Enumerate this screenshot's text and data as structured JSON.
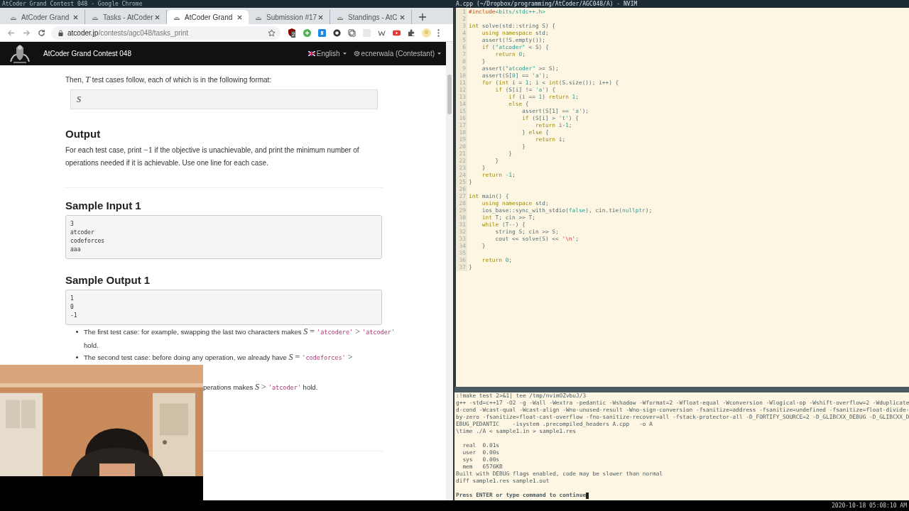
{
  "screen_title": "AtCoder Grand Contest 048 - Google Chrome",
  "browser": {
    "tabs": [
      {
        "title": "AtCoder Grand",
        "selected": false
      },
      {
        "title": "Tasks - AtCoder",
        "selected": false
      },
      {
        "title": "AtCoder Grand",
        "selected": true
      },
      {
        "title": "Submission #17",
        "selected": false
      },
      {
        "title": "Standings - AtC",
        "selected": false
      }
    ],
    "address": {
      "domain": "atcoder.jp",
      "path": "/contests/agc048/tasks_print"
    },
    "extension_badge": "2",
    "site_nav": {
      "title": "AtCoder Grand Contest 048",
      "language": "English",
      "user": "ecnerwala (Contestant)"
    },
    "content": [
      {
        "kind": "para",
        "segments": [
          {
            "kind": "t",
            "text": "Then, "
          },
          {
            "kind": "m",
            "text": "T"
          },
          {
            "kind": "t",
            "text": " test cases follow, each of which is in the following format:"
          }
        ]
      },
      {
        "kind": "formatbox",
        "text": "S"
      },
      {
        "kind": "heading",
        "text": "Output"
      },
      {
        "kind": "para",
        "segments": [
          {
            "kind": "t",
            "text": "For each test case, print "
          },
          {
            "kind": "n",
            "text": "−1"
          },
          {
            "kind": "t",
            "text": " if the objective is unachievable, and print the minimum number of operations needed if it is achievable. Use one line for each case."
          }
        ]
      },
      {
        "kind": "rule"
      },
      {
        "kind": "heading",
        "text": "Sample Input 1"
      },
      {
        "kind": "pre",
        "lines": [
          "3",
          "atcoder",
          "codeforces",
          "aaa"
        ]
      },
      {
        "kind": "heading",
        "text": "Sample Output 1"
      },
      {
        "kind": "pre",
        "lines": [
          "1",
          "0",
          "-1"
        ]
      },
      {
        "kind": "bullets",
        "items": [
          [
            {
              "kind": "t",
              "text": "The first test case: for example, swapping the last two characters makes "
            },
            {
              "kind": "m",
              "text": "S"
            },
            {
              "kind": "n",
              "text": " = "
            },
            {
              "kind": "c",
              "text": "'atcodere'"
            },
            {
              "kind": "n",
              "text": " > "
            },
            {
              "kind": "c",
              "text": "'atcoder'"
            },
            {
              "kind": "t",
              "text": " hold."
            }
          ],
          [
            {
              "kind": "t",
              "text": "The second test case: before doing any operation, we already have "
            },
            {
              "kind": "m",
              "text": "S"
            },
            {
              "kind": "n",
              "text": " = "
            },
            {
              "kind": "c",
              "text": "'codeforces'"
            },
            {
              "kind": "n",
              "text": " >"
            }
          ]
        ]
      },
      {
        "kind": "fragment",
        "segments": [
          {
            "kind": "t",
            "text": "perations makes "
          },
          {
            "kind": "m",
            "text": "S"
          },
          {
            "kind": "n",
            "text": " > "
          },
          {
            "kind": "c",
            "text": "'atcoder'"
          },
          {
            "kind": "t",
            "text": " hold."
          }
        ]
      },
      {
        "kind": "rule"
      }
    ]
  },
  "editor": {
    "title": "A.cpp (~/Dropbox/programming/AtCoder/AGC048/A) - NVIM",
    "lines": [
      {
        "number": "1",
        "code": [
          {
            "text": "#include",
            "kind": "pre"
          },
          {
            "text": "<bits/stdc++.h>",
            "kind": "str"
          }
        ]
      },
      {
        "number": "2"
      },
      {
        "number": "3",
        "code": [
          {
            "text": "int",
            "kind": "kw"
          },
          {
            "text": " solve(std::string S) {",
            "kind": "plain"
          }
        ]
      },
      {
        "number": "4",
        "code": [
          {
            "text": "    using namespace",
            "kind": "kw"
          },
          {
            "text": " std;",
            "kind": "plain"
          }
        ]
      },
      {
        "number": "5",
        "code": [
          {
            "text": "    assert(!S.empty());",
            "kind": "plain"
          }
        ]
      },
      {
        "number": "6",
        "code": [
          {
            "text": "    if",
            "kind": "kw"
          },
          {
            "text": " (",
            "kind": "plain"
          },
          {
            "text": "\"atcoder\"",
            "kind": "str"
          },
          {
            "text": " < S) {",
            "kind": "plain"
          }
        ]
      },
      {
        "number": "7",
        "code": [
          {
            "text": "        return ",
            "kind": "kw"
          },
          {
            "text": "0",
            "kind": "num"
          },
          {
            "text": ";",
            "kind": "plain"
          }
        ]
      },
      {
        "number": "8",
        "code": [
          {
            "text": "    }",
            "kind": "plain"
          }
        ]
      },
      {
        "number": "9",
        "code": [
          {
            "text": "    assert(",
            "kind": "plain"
          },
          {
            "text": "\"atcoder\"",
            "kind": "str"
          },
          {
            "text": " >= S);",
            "kind": "plain"
          }
        ]
      },
      {
        "number": "10",
        "code": [
          {
            "text": "    assert(S[",
            "kind": "plain"
          },
          {
            "text": "0",
            "kind": "num"
          },
          {
            "text": "] == ",
            "kind": "plain"
          },
          {
            "text": "'a'",
            "kind": "str"
          },
          {
            "text": ");",
            "kind": "plain"
          }
        ]
      },
      {
        "number": "11",
        "code": [
          {
            "text": "    for",
            "kind": "kw"
          },
          {
            "text": " (",
            "kind": "plain"
          },
          {
            "text": "int",
            "kind": "kw"
          },
          {
            "text": " i = ",
            "kind": "plain"
          },
          {
            "text": "1",
            "kind": "num"
          },
          {
            "text": "; i < ",
            "kind": "plain"
          },
          {
            "text": "int",
            "kind": "kw"
          },
          {
            "text": "(S.size()); i++) {",
            "kind": "plain"
          }
        ]
      },
      {
        "number": "12",
        "code": [
          {
            "text": "        if",
            "kind": "kw"
          },
          {
            "text": " (S[i] != ",
            "kind": "plain"
          },
          {
            "text": "'a'",
            "kind": "str"
          },
          {
            "text": ") {",
            "kind": "plain"
          }
        ]
      },
      {
        "number": "13",
        "code": [
          {
            "text": "            if",
            "kind": "kw"
          },
          {
            "text": " (i == ",
            "kind": "plain"
          },
          {
            "text": "1",
            "kind": "num"
          },
          {
            "text": ") ",
            "kind": "plain"
          },
          {
            "text": "return ",
            "kind": "kw"
          },
          {
            "text": "1",
            "kind": "num"
          },
          {
            "text": ";",
            "kind": "plain"
          }
        ]
      },
      {
        "number": "14",
        "code": [
          {
            "text": "            else",
            "kind": "kw"
          },
          {
            "text": " {",
            "kind": "plain"
          }
        ]
      },
      {
        "number": "15",
        "code": [
          {
            "text": "                assert(S[1] == ",
            "kind": "plain"
          },
          {
            "text": "'a'",
            "kind": "str"
          },
          {
            "text": ");",
            "kind": "plain"
          }
        ]
      },
      {
        "number": "16",
        "code": [
          {
            "text": "                if",
            "kind": "kw"
          },
          {
            "text": " (S[i] > ",
            "kind": "plain"
          },
          {
            "text": "'t'",
            "kind": "str"
          },
          {
            "text": ") {",
            "kind": "plain"
          }
        ]
      },
      {
        "number": "17",
        "code": [
          {
            "text": "                    return",
            "kind": "kw"
          },
          {
            "text": " i-",
            "kind": "plain"
          },
          {
            "text": "1",
            "kind": "num"
          },
          {
            "text": ";",
            "kind": "plain"
          }
        ]
      },
      {
        "number": "18",
        "code": [
          {
            "text": "                } ",
            "kind": "plain"
          },
          {
            "text": "else",
            "kind": "kw"
          },
          {
            "text": " {",
            "kind": "plain"
          }
        ]
      },
      {
        "number": "19",
        "code": [
          {
            "text": "                    return",
            "kind": "kw"
          },
          {
            "text": " i;",
            "kind": "plain"
          }
        ]
      },
      {
        "number": "20",
        "code": [
          {
            "text": "                }",
            "kind": "plain"
          }
        ]
      },
      {
        "number": "21",
        "code": [
          {
            "text": "            }",
            "kind": "plain"
          }
        ]
      },
      {
        "number": "22",
        "code": [
          {
            "text": "        }",
            "kind": "plain"
          }
        ]
      },
      {
        "number": "23",
        "code": [
          {
            "text": "    }",
            "kind": "plain"
          }
        ]
      },
      {
        "number": "24",
        "code": [
          {
            "text": "    return ",
            "kind": "kw"
          },
          {
            "text": "-1",
            "kind": "num"
          },
          {
            "text": ";",
            "kind": "plain"
          }
        ]
      },
      {
        "number": "25",
        "code": [
          {
            "text": "}",
            "kind": "plain"
          }
        ]
      },
      {
        "number": "26"
      },
      {
        "number": "27",
        "code": [
          {
            "text": "int",
            "kind": "kw"
          },
          {
            "text": " main() {",
            "kind": "plain"
          }
        ]
      },
      {
        "number": "28",
        "code": [
          {
            "text": "    using namespace",
            "kind": "kw"
          },
          {
            "text": " std;",
            "kind": "plain"
          }
        ]
      },
      {
        "number": "29",
        "code": [
          {
            "text": "    ios_base::sync_with_stdio(",
            "kind": "plain"
          },
          {
            "text": "false",
            "kind": "num"
          },
          {
            "text": "), cin.tie(",
            "kind": "plain"
          },
          {
            "text": "nullptr",
            "kind": "num"
          },
          {
            "text": ");",
            "kind": "plain"
          }
        ]
      },
      {
        "number": "30",
        "code": [
          {
            "text": "    int",
            "kind": "kw"
          },
          {
            "text": " T; cin >> T;",
            "kind": "plain"
          }
        ]
      },
      {
        "number": "31",
        "code": [
          {
            "text": "    while",
            "kind": "kw"
          },
          {
            "text": " (T--) {",
            "kind": "plain"
          }
        ]
      },
      {
        "number": "32",
        "code": [
          {
            "text": "        string S; cin >> S;",
            "kind": "plain"
          }
        ]
      },
      {
        "number": "33",
        "code": [
          {
            "text": "        cout << solve(S) << ",
            "kind": "plain"
          },
          {
            "text": "'\\n'",
            "kind": "esc"
          },
          {
            "text": ";",
            "kind": "plain"
          }
        ]
      },
      {
        "number": "34",
        "code": [
          {
            "text": "    }",
            "kind": "plain"
          }
        ]
      },
      {
        "number": "35"
      },
      {
        "number": "36",
        "code": [
          {
            "text": "    return ",
            "kind": "kw"
          },
          {
            "text": "0",
            "kind": "num"
          },
          {
            "text": ";",
            "kind": "plain"
          }
        ]
      },
      {
        "number": "37",
        "code": [
          {
            "text": "}",
            "kind": "plain"
          }
        ]
      }
    ]
  },
  "terminal": {
    "blocks": [
      [
        ":!make test 2>&1| tee /tmp/nvimOZvbuJ/3",
        "g++ -std=c++17 -O2 -g -Wall -Wextra -pedantic -Wshadow -Wformat=2 -Wfloat-equal -Wconversion -Wlogical-op -Wshift-overflow=2 -Wduplicate",
        "d-cond -Wcast-qual -Wcast-align -Wno-unused-result -Wno-sign-conversion -fsanitize=address -fsanitize=undefined -fsanitize=float-divide-",
        "by-zero -fsanitize=float-cast-overflow -fno-sanitize-recover=all -fstack-protector-all -D_FORTIFY_SOURCE=2 -D_GLIBCXX_DEBUG -D_GLIBCXX_D",
        "EBUG_PEDANTIC    -isystem .precompiled_headers A.cpp   -o A",
        "\\time ./A < sample1.in > sample1.res"
      ],
      [
        "  real  0.01s",
        "  user  0.00s",
        "  sys   0.00s",
        "  mem   6576KB",
        "Built with DEBUG flags enabled, code may be slower than normal",
        "diff sample1.res sample1.out"
      ],
      [
        "Press ENTER or type command to continue"
      ]
    ]
  },
  "clock": "2020-10-18 05:08:10 AM"
}
